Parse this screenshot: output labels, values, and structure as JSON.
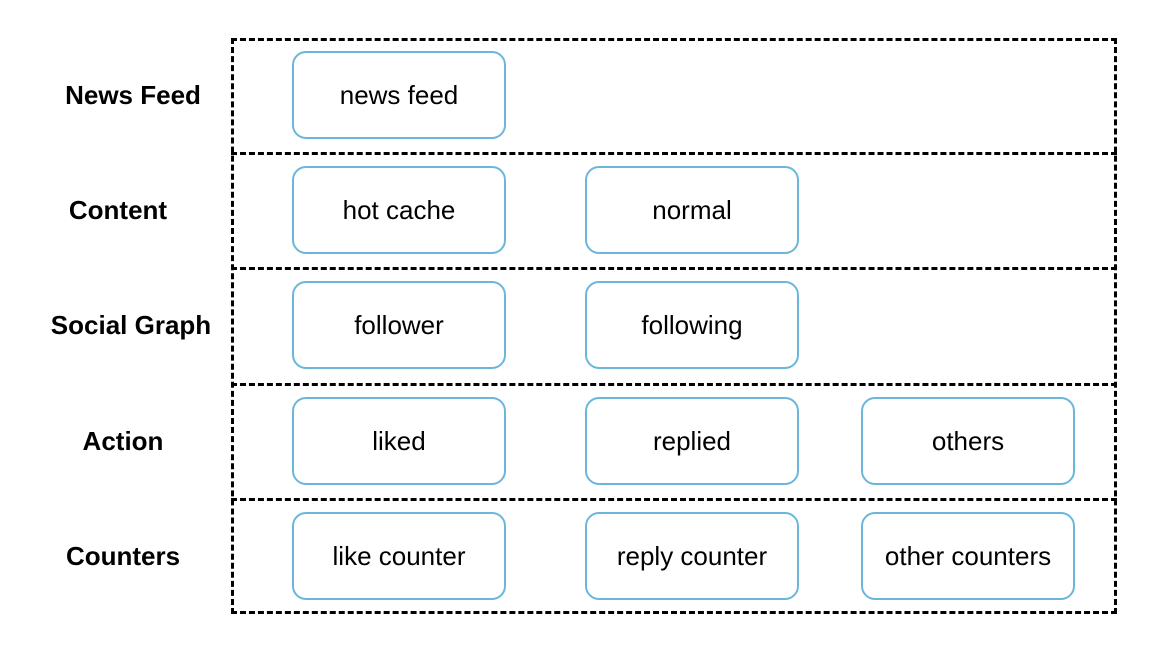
{
  "layers": [
    {
      "label": "News Feed",
      "nodes": [
        "news feed"
      ]
    },
    {
      "label": "Content",
      "nodes": [
        "hot cache",
        "normal"
      ]
    },
    {
      "label": "Social Graph",
      "nodes": [
        "follower",
        "following"
      ]
    },
    {
      "label": "Action",
      "nodes": [
        "liked",
        "replied",
        "others"
      ]
    },
    {
      "label": "Counters",
      "nodes": [
        "like counter",
        "reply counter",
        "other counters"
      ]
    }
  ],
  "colors": {
    "node_border": "#6bb7dc",
    "dashed_border": "#000000"
  }
}
